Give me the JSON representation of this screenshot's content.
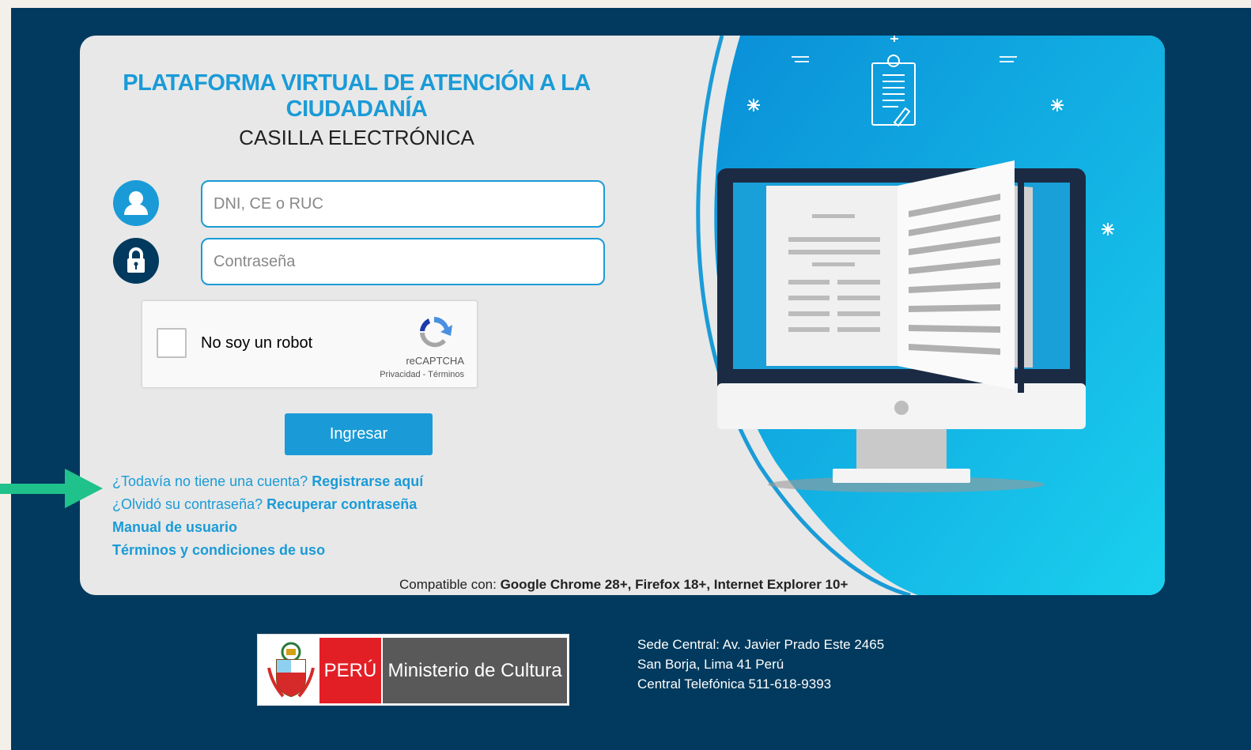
{
  "header": {
    "title_line1": "PLATAFORMA VIRTUAL DE ATENCIÓN A LA",
    "title_line2": "CIUDADANÍA",
    "subtitle": "CASILLA ELECTRÓNICA"
  },
  "form": {
    "dni_placeholder": "DNI, CE o RUC",
    "password_placeholder": "Contraseña",
    "submit_label": "Ingresar"
  },
  "captcha": {
    "label": "No soy un robot",
    "brand": "reCAPTCHA",
    "links": "Privacidad - Términos"
  },
  "links": {
    "no_account_text": "¿Todavía no tiene una cuenta?",
    "register_link": "Registrarse aquí",
    "forgot_text": "¿Olvidó su contraseña?",
    "recover_link": "Recuperar contraseña",
    "manual_link": "Manual de usuario",
    "terms_link": "Términos y condiciones de uso"
  },
  "compat": {
    "prefix": "Compatible con:",
    "browsers": "Google Chrome 28+, Firefox 18+, Internet Explorer 10+"
  },
  "footer": {
    "logo_peru": "PERÚ",
    "logo_ministry": "Ministerio de Cultura",
    "address_line1": "Sede Central: Av. Javier Prado Este 2465",
    "address_line2": "San Borja, Lima 41 Perú",
    "address_line3": "Central Telefónica 511-618-9393"
  },
  "icons": {
    "user": "user-icon",
    "lock": "lock-icon",
    "recaptcha": "recaptcha-icon",
    "arrow": "arrow-right-icon",
    "illustration": "computer-book-illustration"
  },
  "colors": {
    "primary": "#1a9bd7",
    "dark": "#013a5e",
    "arrow": "#1fc28a",
    "peru_red": "#e31f26"
  }
}
